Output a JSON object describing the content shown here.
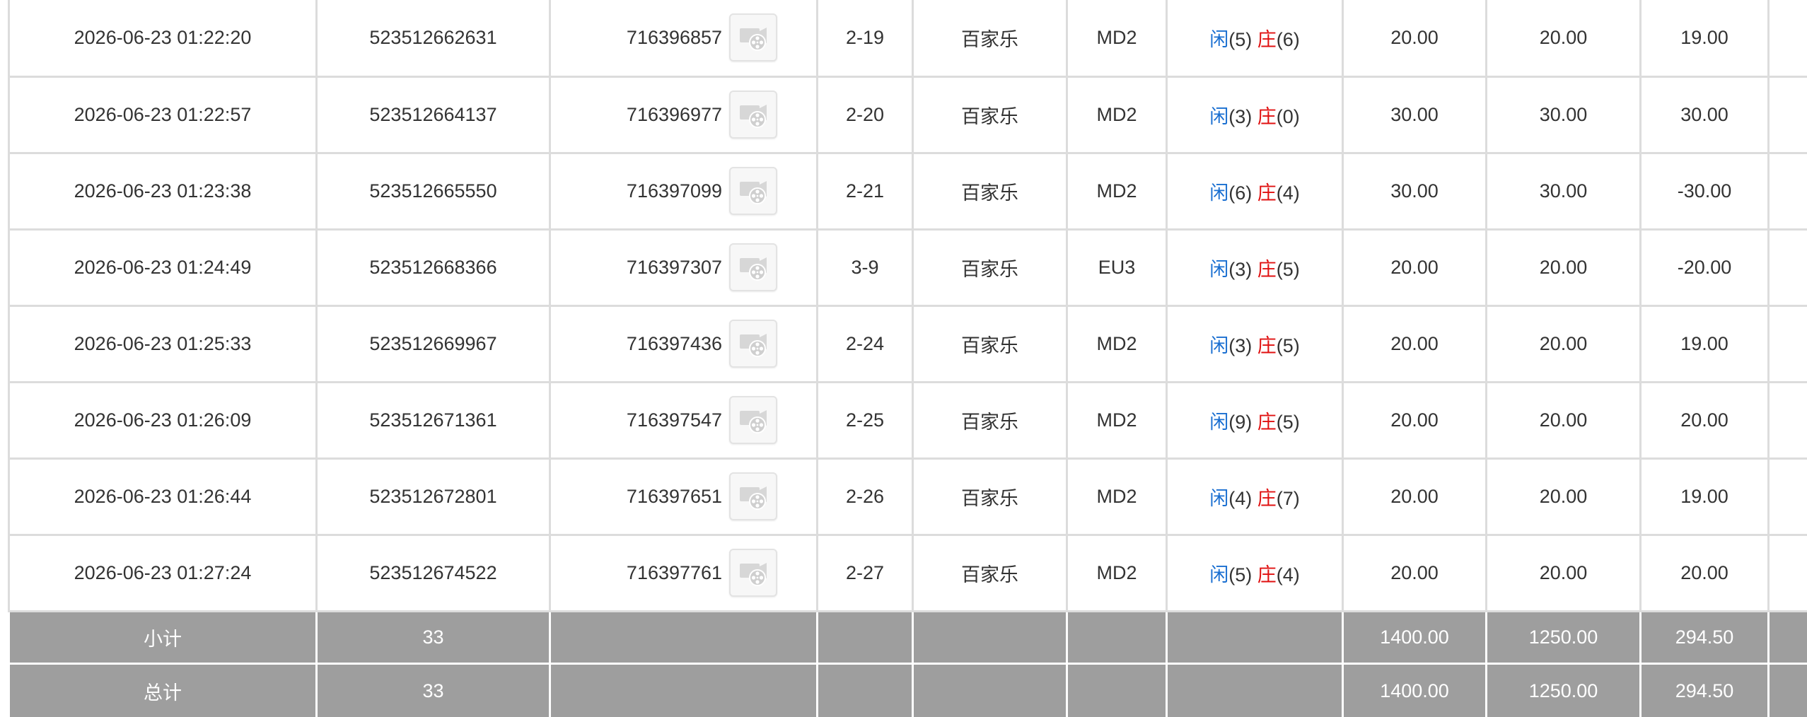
{
  "rows": [
    {
      "time": "2026-06-23 01:22:20",
      "order_no": "523512662631",
      "game_no": "716396857",
      "shoe": "2-19",
      "game_type": "百家乐",
      "table": "MD2",
      "player_label": "闲",
      "player_score": "(5)",
      "banker_label": "庄",
      "banker_score": "(6)",
      "bet": "20.00",
      "valid_bet": "20.00",
      "payout": "19.00",
      "payout_color": "neutral"
    },
    {
      "time": "2026-06-23 01:22:57",
      "order_no": "523512664137",
      "game_no": "716396977",
      "shoe": "2-20",
      "game_type": "百家乐",
      "table": "MD2",
      "player_label": "闲",
      "player_score": "(3)",
      "banker_label": "庄",
      "banker_score": "(0)",
      "bet": "30.00",
      "valid_bet": "30.00",
      "payout": "30.00",
      "payout_color": "neutral"
    },
    {
      "time": "2026-06-23 01:23:38",
      "order_no": "523512665550",
      "game_no": "716397099",
      "shoe": "2-21",
      "game_type": "百家乐",
      "table": "MD2",
      "player_label": "闲",
      "player_score": "(6)",
      "banker_label": "庄",
      "banker_score": "(4)",
      "bet": "30.00",
      "valid_bet": "30.00",
      "payout": "-30.00",
      "payout_color": "red"
    },
    {
      "time": "2026-06-23 01:24:49",
      "order_no": "523512668366",
      "game_no": "716397307",
      "shoe": "3-9",
      "game_type": "百家乐",
      "table": "EU3",
      "player_label": "闲",
      "player_score": "(3)",
      "banker_label": "庄",
      "banker_score": "(5)",
      "bet": "20.00",
      "valid_bet": "20.00",
      "payout": "-20.00",
      "payout_color": "red"
    },
    {
      "time": "2026-06-23 01:25:33",
      "order_no": "523512669967",
      "game_no": "716397436",
      "shoe": "2-24",
      "game_type": "百家乐",
      "table": "MD2",
      "player_label": "闲",
      "player_score": "(3)",
      "banker_label": "庄",
      "banker_score": "(5)",
      "bet": "20.00",
      "valid_bet": "20.00",
      "payout": "19.00",
      "payout_color": "neutral"
    },
    {
      "time": "2026-06-23 01:26:09",
      "order_no": "523512671361",
      "game_no": "716397547",
      "shoe": "2-25",
      "game_type": "百家乐",
      "table": "MD2",
      "player_label": "闲",
      "player_score": "(9)",
      "banker_label": "庄",
      "banker_score": "(5)",
      "bet": "20.00",
      "valid_bet": "20.00",
      "payout": "20.00",
      "payout_color": "neutral"
    },
    {
      "time": "2026-06-23 01:26:44",
      "order_no": "523512672801",
      "game_no": "716397651",
      "shoe": "2-26",
      "game_type": "百家乐",
      "table": "MD2",
      "player_label": "闲",
      "player_score": "(4)",
      "banker_label": "庄",
      "banker_score": "(7)",
      "bet": "20.00",
      "valid_bet": "20.00",
      "payout": "19.00",
      "payout_color": "neutral"
    },
    {
      "time": "2026-06-23 01:27:24",
      "order_no": "523512674522",
      "game_no": "716397761",
      "shoe": "2-27",
      "game_type": "百家乐",
      "table": "MD2",
      "player_label": "闲",
      "player_score": "(5)",
      "banker_label": "庄",
      "banker_score": "(4)",
      "bet": "20.00",
      "valid_bet": "20.00",
      "payout": "20.00",
      "payout_color": "neutral"
    }
  ],
  "summary": [
    {
      "label": "小计",
      "count": "33",
      "bet": "1400.00",
      "valid_bet": "1250.00",
      "payout": "294.50"
    },
    {
      "label": "总计",
      "count": "33",
      "bet": "1400.00",
      "valid_bet": "1250.00",
      "payout": "294.50"
    }
  ],
  "icons": {
    "replay": "video-replay-icon"
  },
  "colors": {
    "player": "#1a6fd1",
    "banker": "#e01010",
    "bet": "#1a6fd1",
    "loss": "#d0021b",
    "summary_bg": "#9e9e9e",
    "grid": "#dcdcdc"
  }
}
